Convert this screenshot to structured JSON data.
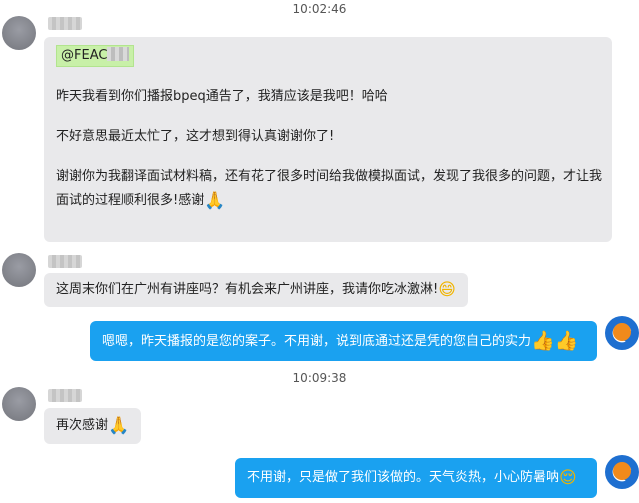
{
  "timestamps": [
    "10:02:46",
    "10:09:38"
  ],
  "messages": [
    {
      "mention": "@FEAC",
      "lines": [
        "昨天我看到你们播报bpeq通告了，我猜应该是我吧！哈哈",
        "不好意思最近太忙了，这才想到得认真谢谢你了!",
        "谢谢你为我翻译面试材料稿，还有花了很多时间给我做模拟面试，发现了我很多的问题，才让我",
        "面试的过程顺利很多!感谢"
      ],
      "emoji": "folded-hands"
    },
    {
      "text": "这周末你们在广州有讲座吗？有机会来广州讲座，我请你吃冰激淋!",
      "emoji": "grinning-face"
    },
    {
      "text": "嗯嗯，昨天播报的是您的案子。不用谢，说到底通过还是凭的您自己的实力",
      "emoji": "thumbs-up-x2"
    },
    {
      "text": "再次感谢",
      "emoji": "folded-hands"
    },
    {
      "text": "不用谢，只是做了我们该做的。天气炎热，小心防暑呐",
      "emoji": "smiling-face"
    }
  ],
  "icons": {
    "pray": "🙏",
    "grin": "😄",
    "thumb": "👍",
    "smile": "😌"
  },
  "colors": {
    "incoming_bubble": "#e9e9eb",
    "outgoing_bubble": "#1aa1f0",
    "mention_highlight": "#c8f0a8"
  }
}
